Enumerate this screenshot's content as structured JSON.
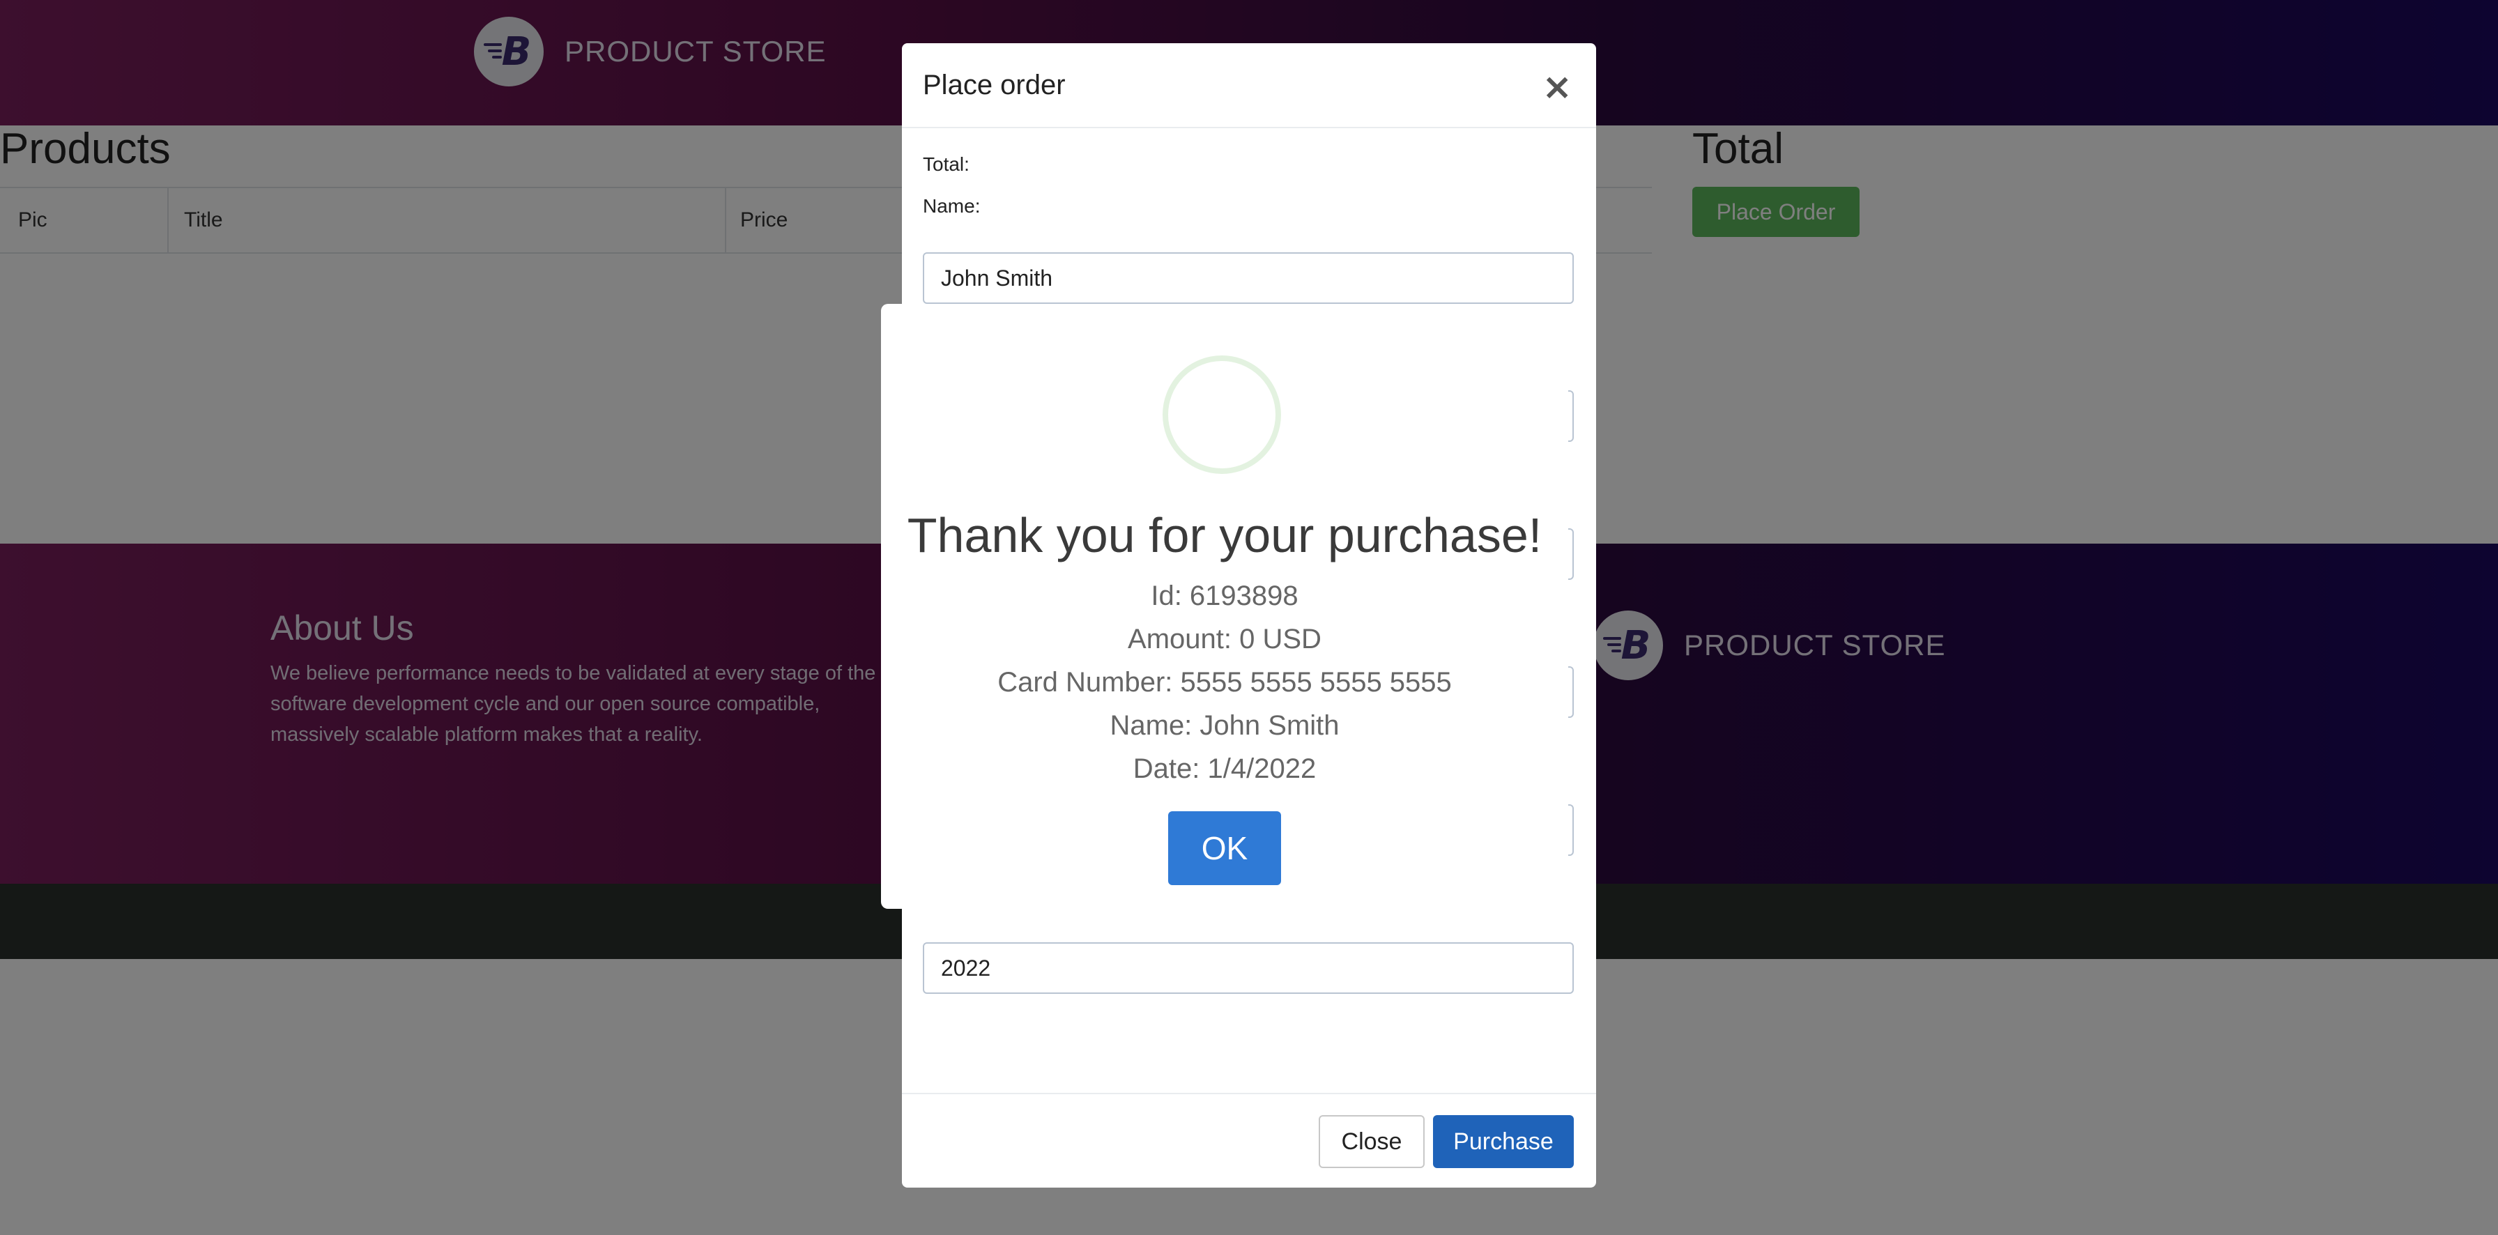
{
  "navbar": {
    "brand": "PRODUCT STORE",
    "logo_letter": "B"
  },
  "products": {
    "title": "Products",
    "columns": [
      "Pic",
      "Title",
      "Price"
    ]
  },
  "total": {
    "title": "Total",
    "place_order_label": "Place Order"
  },
  "footer": {
    "about_title": "About Us",
    "about_text": "We believe performance needs to be validated at every stage of the software development cycle and our open source compatible, massively scalable platform makes that a reality.",
    "brand": "PRODUCT STORE"
  },
  "order_modal": {
    "title": "Place order",
    "close_symbol": "×",
    "total_label": "Total:",
    "name_label": "Name:",
    "name_value": "John Smith",
    "year_value": "2022",
    "close_label": "Close",
    "purchase_label": "Purchase"
  },
  "alert": {
    "title": "Thank you for your purchase!",
    "id_line": "Id: 6193898",
    "amount_line": "Amount: 0 USD",
    "card_line": "Card Number: 5555 5555 5555 5555",
    "name_line": "Name: John Smith",
    "date_line": "Date: 1/4/2022",
    "ok_label": "OK",
    "icon": "success-icon"
  }
}
